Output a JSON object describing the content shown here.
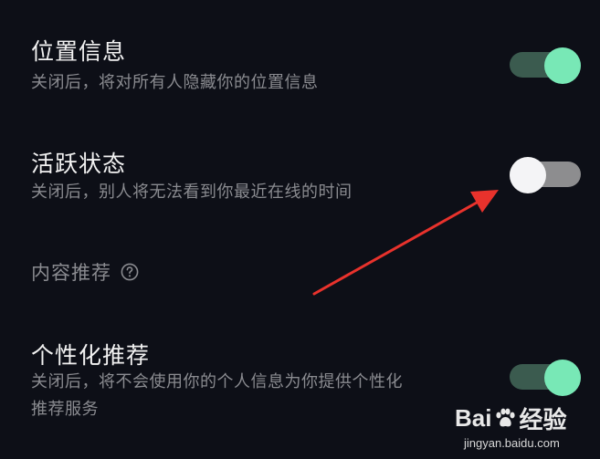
{
  "settings": {
    "location": {
      "title": "位置信息",
      "desc": "关闭后，将对所有人隐藏你的位置信息",
      "enabled": true
    },
    "active_status": {
      "title": "活跃状态",
      "desc": "关闭后，别人将无法看到你最近在线的时间",
      "enabled": false
    },
    "content_section": {
      "label": "内容推荐"
    },
    "personalized": {
      "title": "个性化推荐",
      "desc_line1": "关闭后，将不会使用你的个人信息为你提供个性化",
      "desc_line2": "推荐服务",
      "enabled": true
    }
  },
  "watermark": {
    "brand_left": "Bai",
    "brand_right": "经验",
    "url": "jingyan.baidu.com"
  },
  "colors": {
    "background": "#0d0f17",
    "toggle_on_knob": "#78e8b6",
    "toggle_on_track": "#3b5b4f",
    "toggle_off_knob": "#f4f4f6",
    "toggle_off_track": "#8d8d8f",
    "arrow": "#e8322c"
  },
  "icons": {
    "help": "question-circle-icon",
    "brand": "paw-icon"
  }
}
